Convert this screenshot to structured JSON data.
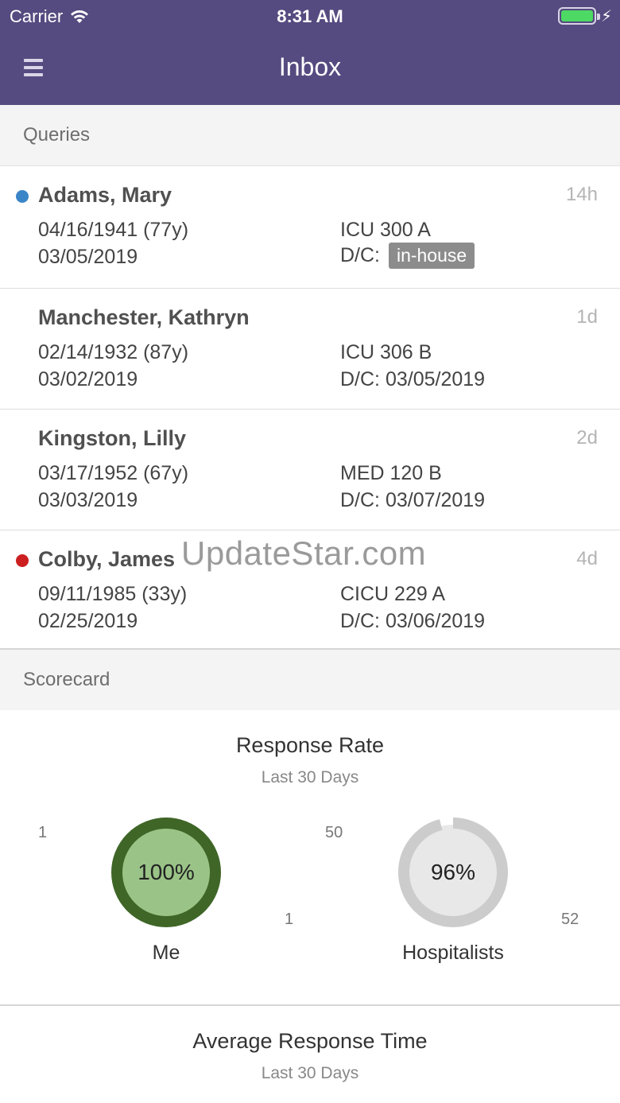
{
  "status_bar": {
    "carrier": "Carrier",
    "time": "8:31 AM"
  },
  "header": {
    "title": "Inbox"
  },
  "queries": {
    "section_label": "Queries",
    "items": [
      {
        "name": "Adams, Mary",
        "age": "14h",
        "dob": "04/16/1941 (77y)",
        "admit": "03/05/2019",
        "location": "ICU 300 A",
        "dc_label": "D/C:",
        "dc_value": "in-house",
        "dot_color": "#3a85c8"
      },
      {
        "name": "Manchester, Kathryn",
        "age": "1d",
        "dob": "02/14/1932 (87y)",
        "admit": "03/02/2019",
        "location": "ICU 306 B",
        "dc_label": "D/C: 03/05/2019"
      },
      {
        "name": "Kingston, Lilly",
        "age": "2d",
        "dob": "03/17/1952 (67y)",
        "admit": "03/03/2019",
        "location": "MED 120 B",
        "dc_label": "D/C: 03/07/2019"
      },
      {
        "name": "Colby, James",
        "age": "4d",
        "dob": "09/11/1985 (33y)",
        "admit": "02/25/2019",
        "location": "CICU 229 A",
        "dc_label": "D/C: 03/06/2019",
        "dot_color": "#cc1f1f"
      }
    ]
  },
  "watermark": "UpdateStar.com",
  "scorecard": {
    "section_label": "Scorecard",
    "response_rate": {
      "title": "Response Rate",
      "subtitle": "Last 30 Days",
      "me": {
        "label": "Me",
        "percent_text": "100%",
        "fraction": 1.0,
        "axis_top": "1"
      },
      "hospitalists": {
        "label": "Hospitalists",
        "percent_text": "96%",
        "fraction": 0.96,
        "axis_top": "50",
        "axis_left": "1",
        "axis_right": "52"
      }
    },
    "avg_response_time": {
      "title": "Average Response Time",
      "subtitle": "Last 30 Days"
    }
  },
  "colors": {
    "header_bg": "#554b80",
    "me_ring": "#3f6627",
    "me_fill": "#9ac487",
    "hosp_ring": "#cccccc",
    "hosp_fill": "#e8e8e8"
  }
}
